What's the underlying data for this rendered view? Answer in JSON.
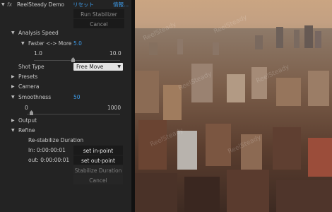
{
  "header": {
    "fx_label": "fx",
    "effect_name": "ReelSteady Demo",
    "reset_label": "リセット",
    "about_label": "情報..."
  },
  "buttons": {
    "run_stabilizer": "Run Stabilizer",
    "cancel_top": "Cancel",
    "set_in_point": "set in-point",
    "set_out_point": "set out-point",
    "stabilize_duration": "Stabilize Duration",
    "cancel_bottom": "Cancel"
  },
  "analysis_speed": {
    "label": "Analysis Speed",
    "param_label": "Faster <-> More",
    "value": "5.0",
    "min": "1.0",
    "max": "10.0"
  },
  "shot_type": {
    "label": "Shot Type",
    "selected": "Free Move"
  },
  "groups": {
    "presets": "Presets",
    "camera": "Camera",
    "output": "Output",
    "refine": "Refine"
  },
  "smoothness": {
    "label": "Smoothness",
    "value": "50",
    "min": "0",
    "max": "1000"
  },
  "refine": {
    "restabilize_label": "Re-stabilize Duration",
    "in_label": "In: 0:00:00:01",
    "out_label": "out: 0:00:00:01"
  },
  "viewer": {
    "watermark": "ReelSteady"
  },
  "colors": {
    "accent_blue": "#3d9be9",
    "panel_bg": "#232323"
  }
}
